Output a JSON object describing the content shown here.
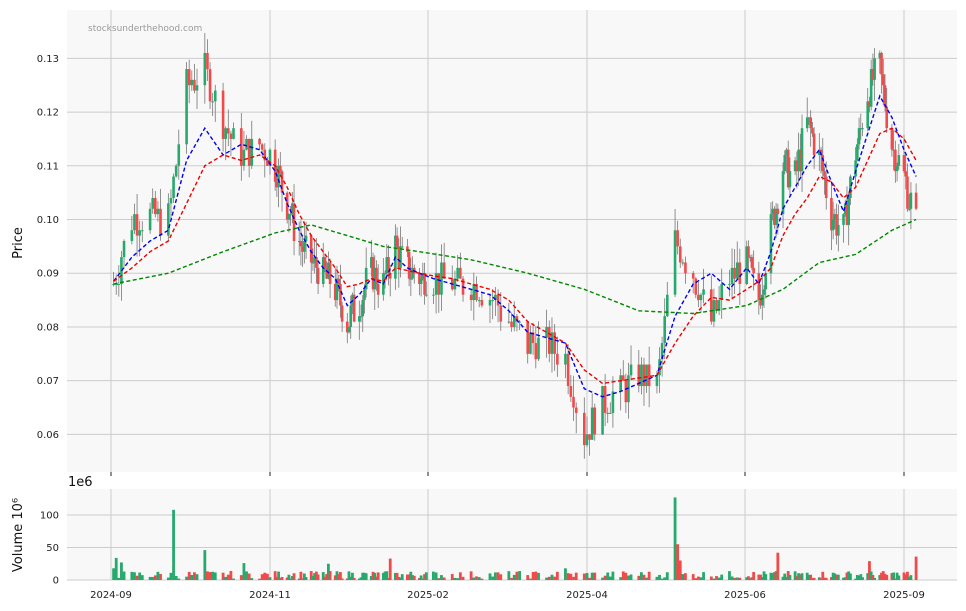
{
  "watermark": "stocksunderthehood.com",
  "colors": {
    "up": "#26a96c",
    "down": "#f04a4a",
    "ma_short": "#0000ee",
    "ma_mid": "#ee0000",
    "ma_long": "#008800",
    "panel_bg": "#f8f8f8",
    "grid": "#cccccc"
  },
  "chart_data": [
    {
      "type": "candlestick",
      "ylabel": "Price",
      "xlabel": "",
      "ylim": [
        0.053,
        0.139
      ],
      "yticks": [
        0.06,
        0.07,
        0.08,
        0.09,
        0.1,
        0.11,
        0.12,
        0.13
      ],
      "ytick_labels": [
        "0.06",
        "0.07",
        "0.08",
        "0.09",
        "0.10",
        "0.11",
        "0.12",
        "0.13"
      ],
      "x_dates": [
        "2024-09",
        "2024-11",
        "2025-02",
        "2025-04",
        "2025-06",
        "2025-09"
      ],
      "grid": true,
      "price_path": [
        [
          "2024-09-02",
          0.088
        ],
        [
          "2024-09-09",
          0.1
        ],
        [
          "2024-09-16",
          0.101
        ],
        [
          "2024-09-23",
          0.1
        ],
        [
          "2024-09-30",
          0.125
        ],
        [
          "2024-10-07",
          0.128
        ],
        [
          "2024-10-14",
          0.118
        ],
        [
          "2024-10-21",
          0.112
        ],
        [
          "2024-10-28",
          0.114
        ],
        [
          "2024-11-04",
          0.11
        ],
        [
          "2024-11-11",
          0.103
        ],
        [
          "2024-11-18",
          0.096
        ],
        [
          "2024-11-25",
          0.092
        ],
        [
          "2024-12-02",
          0.09
        ],
        [
          "2024-12-09",
          0.087
        ],
        [
          "2024-12-16",
          0.081
        ],
        [
          "2024-12-23",
          0.085
        ],
        [
          "2024-12-30",
          0.09
        ],
        [
          "2025-01-06",
          0.088
        ],
        [
          "2025-01-13",
          0.095
        ],
        [
          "2025-01-20",
          0.091
        ],
        [
          "2025-01-27",
          0.089
        ],
        [
          "2025-02-03",
          0.089
        ],
        [
          "2025-02-10",
          0.088
        ],
        [
          "2025-02-17",
          0.088
        ],
        [
          "2025-02-24",
          0.086
        ],
        [
          "2025-03-03",
          0.081
        ],
        [
          "2025-03-10",
          0.077
        ],
        [
          "2025-03-17",
          0.077
        ],
        [
          "2025-03-24",
          0.074
        ],
        [
          "2025-03-31",
          0.06
        ],
        [
          "2025-04-07",
          0.066
        ],
        [
          "2025-04-14",
          0.068
        ],
        [
          "2025-04-21",
          0.071
        ],
        [
          "2025-04-28",
          0.069
        ],
        [
          "2025-05-05",
          0.096
        ],
        [
          "2025-05-12",
          0.09
        ],
        [
          "2025-05-19",
          0.081
        ],
        [
          "2025-05-26",
          0.089
        ],
        [
          "2025-06-02",
          0.092
        ],
        [
          "2025-06-09",
          0.085
        ],
        [
          "2025-06-16",
          0.098
        ],
        [
          "2025-06-23",
          0.11
        ],
        [
          "2025-06-30",
          0.108
        ],
        [
          "2025-07-07",
          0.118
        ],
        [
          "2025-07-14",
          0.112
        ],
        [
          "2025-07-21",
          0.101
        ],
        [
          "2025-07-28",
          0.098
        ],
        [
          "2025-08-04",
          0.112
        ],
        [
          "2025-08-11",
          0.124
        ],
        [
          "2025-08-18",
          0.128
        ],
        [
          "2025-08-25",
          0.114
        ],
        [
          "2025-09-01",
          0.108
        ],
        [
          "2025-09-08",
          0.099
        ]
      ],
      "series": [
        {
          "color_key": "ma_short",
          "points": [
            [
              "2024-09-02",
              0.0885
            ],
            [
              "2024-09-09",
              0.093
            ],
            [
              "2024-09-16",
              0.096
            ],
            [
              "2024-09-23",
              0.098
            ],
            [
              "2024-09-30",
              0.111
            ],
            [
              "2024-10-07",
              0.117
            ],
            [
              "2024-10-14",
              0.112
            ],
            [
              "2024-10-21",
              0.114
            ],
            [
              "2024-10-28",
              0.113
            ],
            [
              "2024-11-04",
              0.109
            ],
            [
              "2024-11-11",
              0.103
            ],
            [
              "2024-11-18",
              0.098
            ],
            [
              "2024-11-25",
              0.094
            ],
            [
              "2024-12-02",
              0.091
            ],
            [
              "2024-12-09",
              0.089
            ],
            [
              "2024-12-16",
              0.084
            ],
            [
              "2024-12-23",
              0.086
            ],
            [
              "2024-12-30",
              0.089
            ],
            [
              "2025-01-06",
              0.088
            ],
            [
              "2025-01-13",
              0.093
            ],
            [
              "2025-01-20",
              0.091
            ],
            [
              "2025-01-27",
              0.09
            ],
            [
              "2025-02-03",
              0.089
            ],
            [
              "2025-02-10",
              0.088
            ],
            [
              "2025-02-17",
              0.087
            ],
            [
              "2025-02-24",
              0.086
            ],
            [
              "2025-03-03",
              0.083
            ],
            [
              "2025-03-10",
              0.079
            ],
            [
              "2025-03-17",
              0.078
            ],
            [
              "2025-03-24",
              0.077
            ],
            [
              "2025-03-31",
              0.0685
            ],
            [
              "2025-04-07",
              0.067
            ],
            [
              "2025-04-14",
              0.068
            ],
            [
              "2025-04-21",
              0.0695
            ],
            [
              "2025-04-28",
              0.071
            ],
            [
              "2025-05-05",
              0.082
            ],
            [
              "2025-05-12",
              0.088
            ],
            [
              "2025-05-19",
              0.09
            ],
            [
              "2025-05-26",
              0.087
            ],
            [
              "2025-06-02",
              0.091
            ],
            [
              "2025-06-09",
              0.088
            ],
            [
              "2025-06-16",
              0.094
            ],
            [
              "2025-06-23",
              0.102
            ],
            [
              "2025-06-30",
              0.106
            ],
            [
              "2025-07-07",
              0.11
            ],
            [
              "2025-07-14",
              0.113
            ],
            [
              "2025-07-21",
              0.107
            ],
            [
              "2025-07-28",
              0.1015
            ],
            [
              "2025-08-04",
              0.109
            ],
            [
              "2025-08-11",
              0.116
            ],
            [
              "2025-08-18",
              0.123
            ],
            [
              "2025-08-25",
              0.119
            ],
            [
              "2025-09-01",
              0.113
            ],
            [
              "2025-09-08",
              0.108
            ]
          ]
        },
        {
          "color_key": "ma_mid",
          "points": [
            [
              "2024-09-02",
              0.0885
            ],
            [
              "2024-09-09",
              0.091
            ],
            [
              "2024-09-16",
              0.094
            ],
            [
              "2024-09-23",
              0.096
            ],
            [
              "2024-09-30",
              0.103
            ],
            [
              "2024-10-07",
              0.11
            ],
            [
              "2024-10-14",
              0.112
            ],
            [
              "2024-10-21",
              0.111
            ],
            [
              "2024-10-28",
              0.112
            ],
            [
              "2024-11-04",
              0.11
            ],
            [
              "2024-11-11",
              0.106
            ],
            [
              "2024-11-18",
              0.101
            ],
            [
              "2024-11-25",
              0.097
            ],
            [
              "2024-12-02",
              0.094
            ],
            [
              "2024-12-09",
              0.091
            ],
            [
              "2024-12-16",
              0.0875
            ],
            [
              "2024-12-23",
              0.088
            ],
            [
              "2024-12-30",
              0.089
            ],
            [
              "2025-01-06",
              0.0885
            ],
            [
              "2025-01-13",
              0.091
            ],
            [
              "2025-01-20",
              0.0905
            ],
            [
              "2025-01-27",
              0.09
            ],
            [
              "2025-02-03",
              0.0895
            ],
            [
              "2025-02-10",
              0.089
            ],
            [
              "2025-02-17",
              0.088
            ],
            [
              "2025-02-24",
              0.087
            ],
            [
              "2025-03-03",
              0.085
            ],
            [
              "2025-03-10",
              0.081
            ],
            [
              "2025-03-17",
              0.079
            ],
            [
              "2025-03-24",
              0.077
            ],
            [
              "2025-03-31",
              0.072
            ],
            [
              "2025-04-07",
              0.0695
            ],
            [
              "2025-04-14",
              0.07
            ],
            [
              "2025-04-21",
              0.0705
            ],
            [
              "2025-04-28",
              0.071
            ],
            [
              "2025-05-05",
              0.077
            ],
            [
              "2025-05-12",
              0.082
            ],
            [
              "2025-05-19",
              0.0855
            ],
            [
              "2025-05-26",
              0.085
            ],
            [
              "2025-06-02",
              0.087
            ],
            [
              "2025-06-09",
              0.0885
            ],
            [
              "2025-06-16",
              0.091
            ],
            [
              "2025-06-23",
              0.097
            ],
            [
              "2025-06-30",
              0.101
            ],
            [
              "2025-07-07",
              0.104
            ],
            [
              "2025-07-14",
              0.108
            ],
            [
              "2025-07-21",
              0.107
            ],
            [
              "2025-07-28",
              0.104
            ],
            [
              "2025-08-04",
              0.106
            ],
            [
              "2025-08-11",
              0.111
            ],
            [
              "2025-08-18",
              0.116
            ],
            [
              "2025-08-25",
              0.117
            ],
            [
              "2025-09-01",
              0.115
            ],
            [
              "2025-09-08",
              0.111
            ]
          ]
        },
        {
          "color_key": "ma_long",
          "points": [
            [
              "2024-09-02",
              0.088
            ],
            [
              "2024-09-23",
              0.09
            ],
            [
              "2024-10-14",
              0.094
            ],
            [
              "2024-11-04",
              0.0975
            ],
            [
              "2024-11-25",
              0.099
            ],
            [
              "2024-12-16",
              0.097
            ],
            [
              "2025-01-06",
              0.095
            ],
            [
              "2025-01-27",
              0.094
            ],
            [
              "2025-02-17",
              0.0925
            ],
            [
              "2025-03-10",
              0.09
            ],
            [
              "2025-03-31",
              0.087
            ],
            [
              "2025-04-21",
              0.083
            ],
            [
              "2025-05-12",
              0.0825
            ],
            [
              "2025-06-02",
              0.084
            ],
            [
              "2025-06-23",
              0.087
            ],
            [
              "2025-07-14",
              0.092
            ],
            [
              "2025-08-04",
              0.0935
            ],
            [
              "2025-08-25",
              0.098
            ],
            [
              "2025-09-08",
              0.1
            ]
          ]
        }
      ]
    },
    {
      "type": "bar",
      "ylabel": "Volume  10⁶",
      "offset_label": "1e6",
      "ylim": [
        0,
        140
      ],
      "yticks": [
        0,
        50,
        100
      ],
      "ytick_labels": [
        "0",
        "50",
        "100"
      ],
      "grid": true,
      "spikes": [
        [
          "2024-09-02",
          18
        ],
        [
          "2024-09-03",
          34
        ],
        [
          "2024-09-05",
          27
        ],
        [
          "2024-09-25",
          108
        ],
        [
          "2024-10-07",
          46
        ],
        [
          "2024-10-22",
          26
        ],
        [
          "2024-12-05",
          25
        ],
        [
          "2025-01-10",
          33
        ],
        [
          "2025-03-24",
          18
        ],
        [
          "2025-05-05",
          127
        ],
        [
          "2025-05-06",
          55
        ],
        [
          "2025-05-07",
          30
        ],
        [
          "2025-06-20",
          42
        ],
        [
          "2025-08-12",
          29
        ],
        [
          "2025-09-08",
          36
        ]
      ]
    }
  ]
}
